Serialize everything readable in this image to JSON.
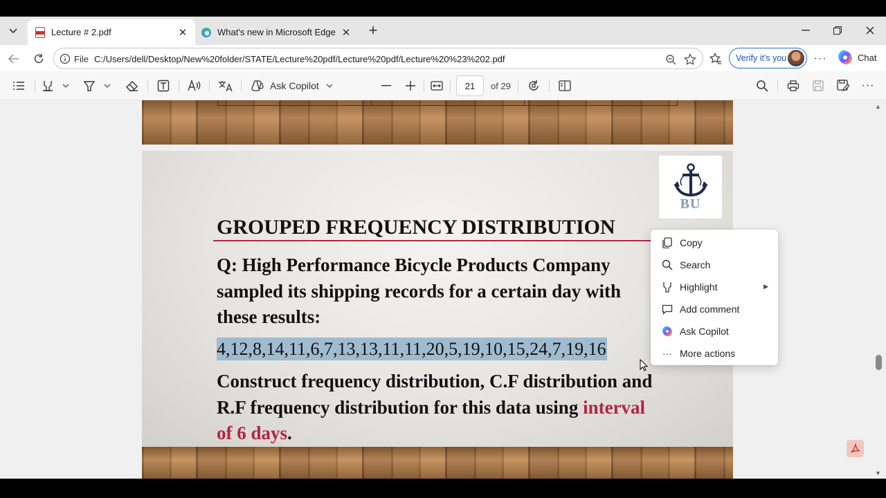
{
  "tabs": [
    {
      "title": "Lecture # 2.pdf",
      "icon": "pdf-icon",
      "active": true
    },
    {
      "title": "What's new in Microsoft Edge",
      "icon": "edge-icon",
      "active": false
    }
  ],
  "address": {
    "scheme": "File",
    "url": "C:/Users/dell/Desktop/New%20folder/STATE/Lecture%20pdf/Lecture%20pdf/Lecture%20%23%202.pdf"
  },
  "profile": {
    "verify_label": "Verify it's you"
  },
  "chat_label": "Chat",
  "pdf_toolbar": {
    "ask_copilot": "Ask Copilot",
    "page_value": "21",
    "page_count": "of 29"
  },
  "slide": {
    "logo_text": "BU",
    "title": "GROUPED FREQUENCY DISTRIBUTION",
    "question": "Q: High Performance Bicycle Products Company sampled its shipping records for a certain day with these results:",
    "data": "4,12,8,14,11,6,7,13,13,11,11,20,5,19,10,15,24,7,19,16",
    "instruction": "Construct frequency distribution, C.F distribution and R.F frequency distribution for this data using ",
    "instruction_accent": "interval of 6 days",
    "instruction_end": "."
  },
  "context_menu": {
    "items": [
      {
        "label": "Copy",
        "icon": "copy-icon"
      },
      {
        "label": "Search",
        "icon": "search-icon"
      },
      {
        "label": "Highlight",
        "icon": "highlight-icon",
        "submenu": true
      },
      {
        "label": "Add comment",
        "icon": "comment-icon"
      },
      {
        "label": "Ask Copilot",
        "icon": "copilot-icon"
      },
      {
        "label": "More actions",
        "icon": "more-icon"
      }
    ]
  },
  "colors": {
    "accent_red": "#b2253f",
    "selection_blue": "#9fbbd0",
    "verify_blue": "#1c58b8"
  }
}
